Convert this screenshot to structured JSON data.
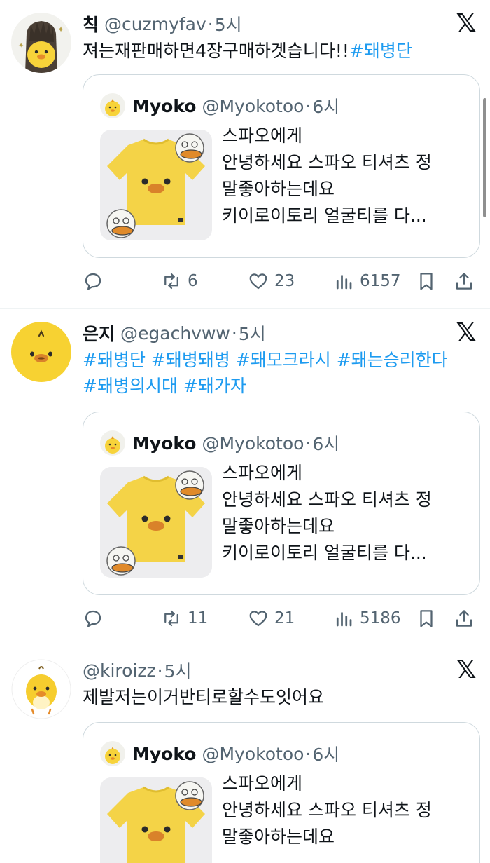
{
  "tweets": [
    {
      "display_name": "칙",
      "handle": "@cuzmyfav",
      "time": "5시",
      "text_plain": "져는재판매하면4장구매하겟습니다!!",
      "text_hashtag": "#돼병단",
      "quote": {
        "name": "Myoko",
        "handle": "@Myokotoo",
        "time": "6시",
        "lines": [
          "스파오에게",
          "안녕하세요 스파오 티셔츠 정",
          "말좋아하는데요",
          "키이로이토리 얼굴티를 다..."
        ]
      },
      "stats": {
        "replies": "",
        "retweets": "6",
        "likes": "23",
        "views": "6157"
      }
    },
    {
      "display_name": "은지",
      "handle": "@egachvww",
      "time": "5시",
      "hashtags_line1": [
        "#돼병단",
        "#돼병돼병",
        "#돼모크라시",
        "#돼는승리한다"
      ],
      "hashtags_line2": [
        "#돼병의시대",
        "#돼가자"
      ],
      "quote": {
        "name": "Myoko",
        "handle": "@Myokotoo",
        "time": "6시",
        "lines": [
          "스파오에게",
          "안녕하세요 스파오 티셔츠 정",
          "말좋아하는데요",
          "키이로이토리 얼굴티를 다..."
        ]
      },
      "stats": {
        "replies": "",
        "retweets": "11",
        "likes": "21",
        "views": "5186"
      }
    },
    {
      "display_name": "",
      "handle": "@kiroizz",
      "time": "5시",
      "text_plain": "제발저는이거반티로할수도잇어요",
      "quote": {
        "name": "Myoko",
        "handle": "@Myokotoo",
        "time": "6시",
        "lines": [
          "스파오에게",
          "안녕하세요 스파오 티셔츠 정",
          "말좋아하는데요"
        ]
      }
    }
  ],
  "separator_dot": "·",
  "icons": [
    "x-logo-icon",
    "reply-icon",
    "retweet-icon",
    "like-icon",
    "views-icon",
    "bookmark-icon",
    "share-icon"
  ],
  "colors": {
    "accent": "#1d9bf0",
    "muted": "#536471",
    "border": "#cfd9de"
  }
}
